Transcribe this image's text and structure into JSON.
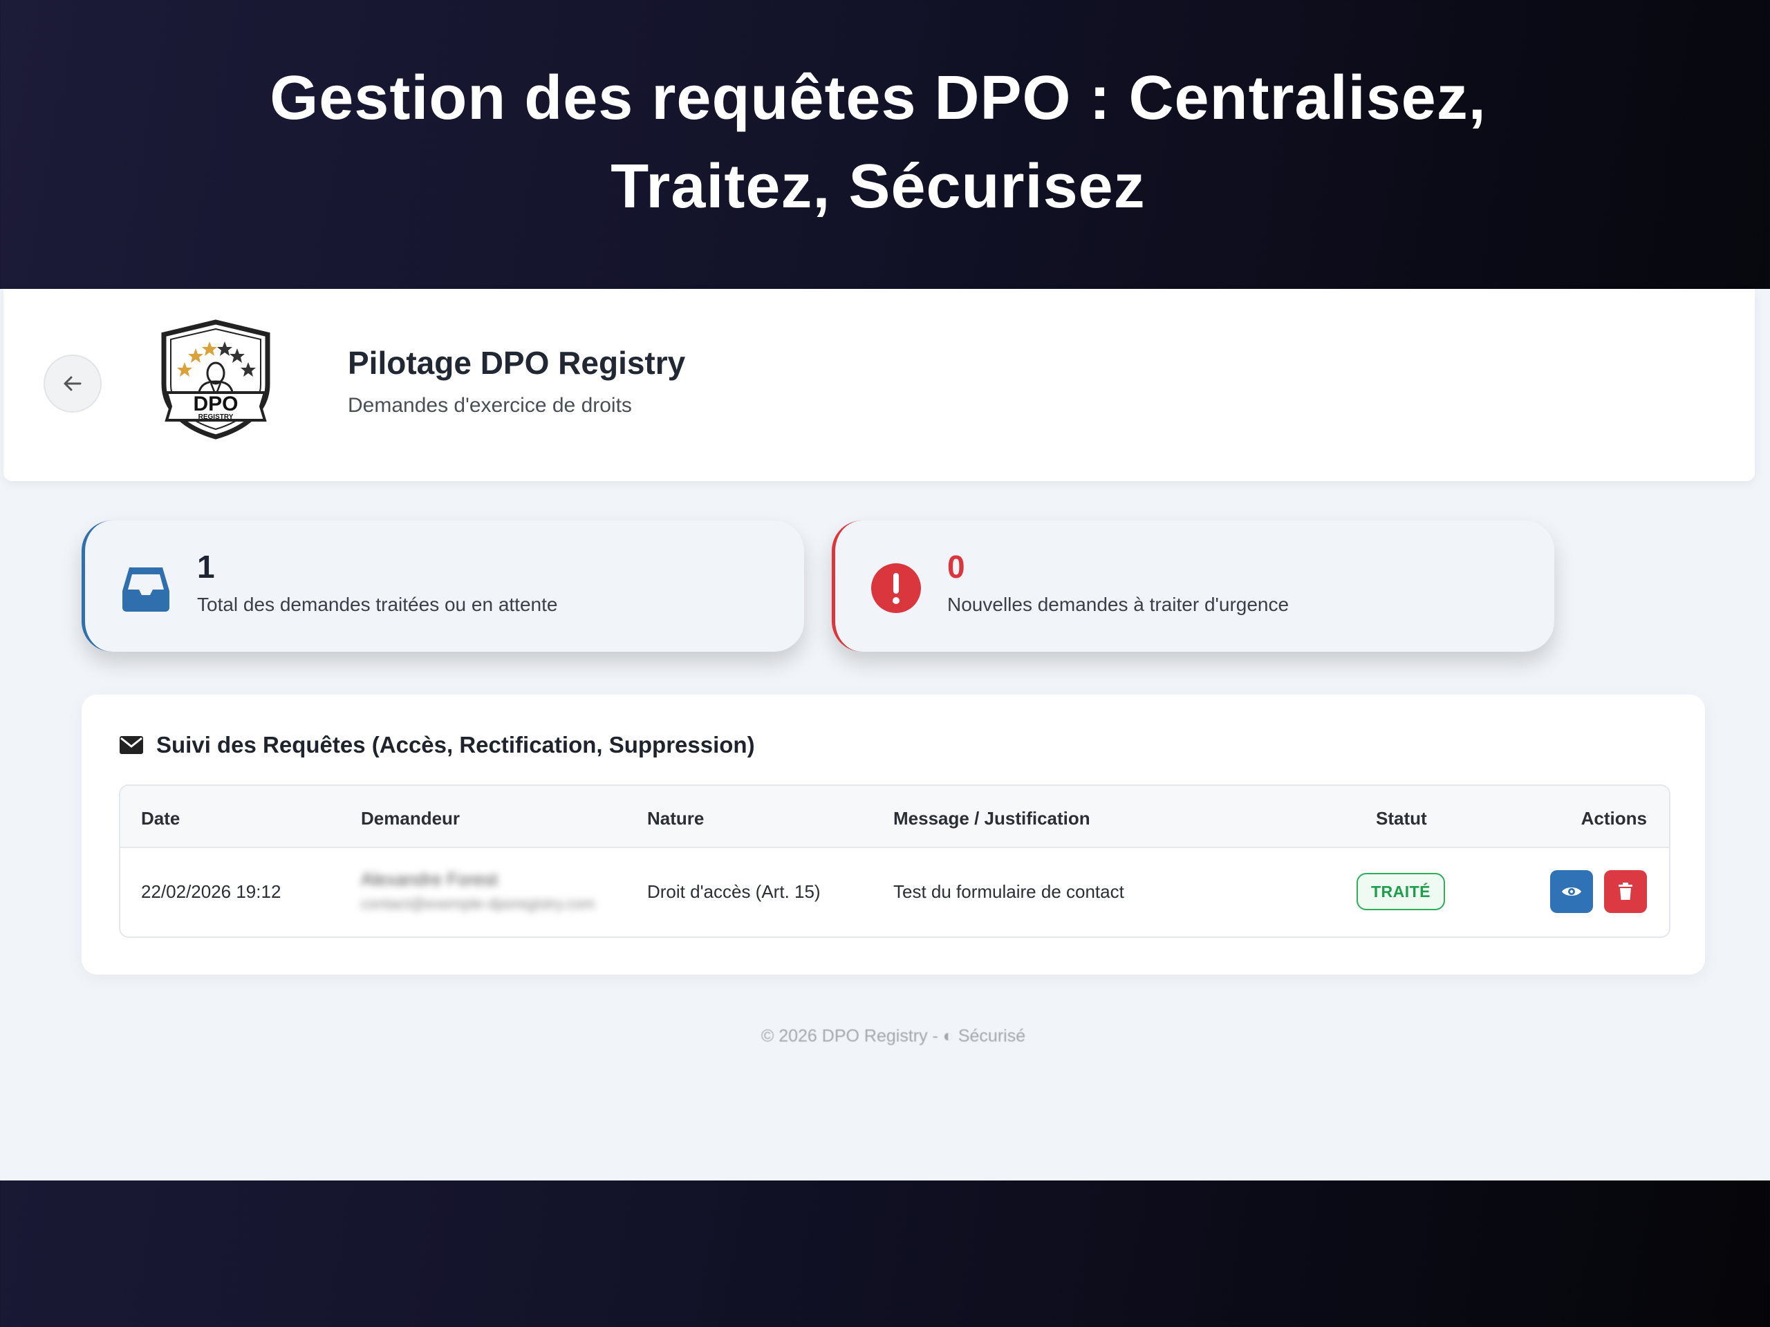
{
  "promo": {
    "title_line1": "Gestion des requêtes DPO : Centralisez,",
    "title_line2": "Traitez, Sécurisez"
  },
  "header": {
    "back_icon": "arrow-left-icon",
    "logo_text": "DPO",
    "logo_subtext": "REGISTRY",
    "title": "Pilotage DPO Registry",
    "subtitle": "Demandes d'exercice de droits"
  },
  "stats": [
    {
      "value": "1",
      "label": "Total des demandes traitées ou en attente",
      "icon": "inbox-icon",
      "color": "#2f6fae"
    },
    {
      "value": "0",
      "label": "Nouvelles demandes à traiter d'urgence",
      "icon": "alert-circle-icon",
      "color": "#d9363e"
    }
  ],
  "panel": {
    "icon": "envelope-icon",
    "title": "Suivi des Requêtes (Accès, Rectification, Suppression)",
    "columns": [
      "Date",
      "Demandeur",
      "Nature",
      "Message / Justification",
      "Statut",
      "Actions"
    ],
    "rows": [
      {
        "date": "22/02/2026 19:12",
        "requester_name": "Alexandre Forest",
        "requester_email": "contact@exemple-dporegistry.com",
        "nature": "Droit d'accès (Art. 15)",
        "message": "Test du formulaire de contact",
        "status": "TRAITÉ"
      }
    ],
    "action_icons": [
      "eye-icon",
      "trash-icon"
    ]
  },
  "footer": {
    "text": "© 2026 DPO Registry - ◐ Sécurisé"
  },
  "colors": {
    "accent_blue": "#2f72b5",
    "danger_red": "#dc3a42",
    "success_green": "#1f9e4c",
    "app_background": "#f1f4f8"
  }
}
